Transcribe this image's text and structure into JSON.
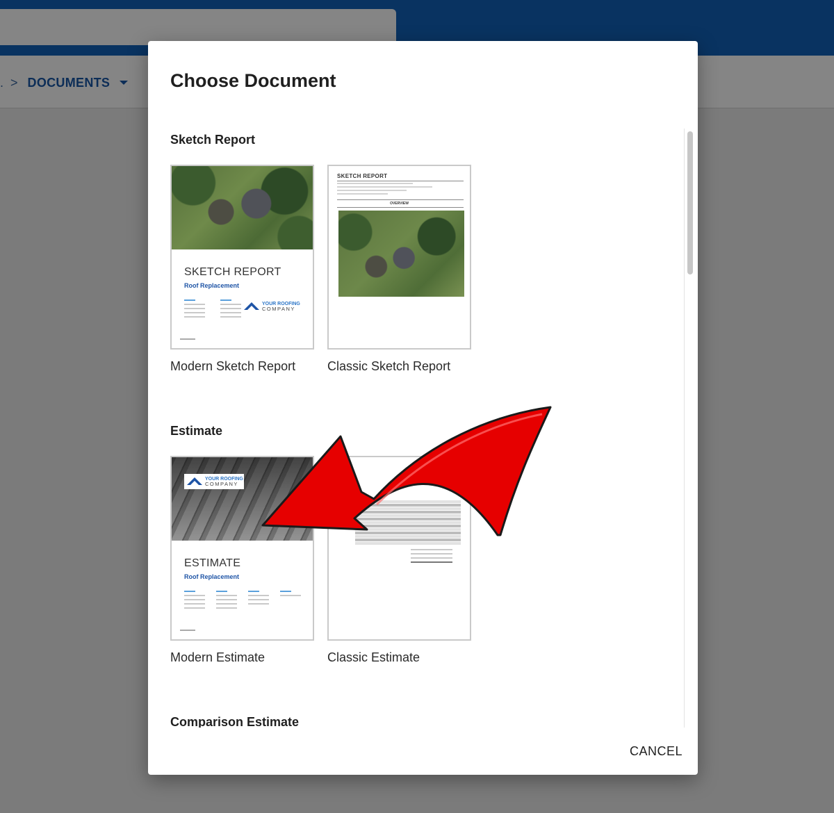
{
  "breadcrumb": {
    "previous": ".",
    "separator": ">",
    "current": "DOCUMENTS"
  },
  "dialog": {
    "title": "Choose Document",
    "cancel_label": "CANCEL",
    "sections": [
      {
        "title": "Sketch Report",
        "items": [
          {
            "label": "Modern Sketch Report",
            "thumb_title": "SKETCH REPORT",
            "thumb_subtitle": "Roof Replacement",
            "logo_line1": "YOUR ROOFING",
            "logo_line2": "COMPANY"
          },
          {
            "label": "Classic Sketch Report",
            "thumb_title": "SKETCH REPORT",
            "thumb_overview": "OVERVIEW"
          }
        ]
      },
      {
        "title": "Estimate",
        "items": [
          {
            "label": "Modern Estimate",
            "thumb_title": "ESTIMATE",
            "thumb_subtitle": "Roof Replacement",
            "logo_line1": "YOUR ROOFING",
            "logo_line2": "COMPANY"
          },
          {
            "label": "Classic Estimate"
          }
        ]
      },
      {
        "title": "Comparison Estimate"
      }
    ]
  },
  "colors": {
    "header_navy": "#093361",
    "accent_blue": "#1e54a6",
    "annotation_arrow": "#e60000"
  }
}
